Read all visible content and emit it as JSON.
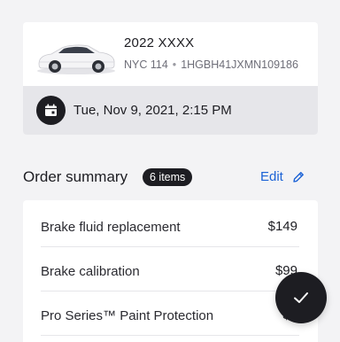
{
  "vehicle": {
    "title": "2022 XXXX",
    "plate": "NYC 114",
    "separator": "•",
    "vin": "1HGBH41JXMN109186",
    "image_icon": "car-image"
  },
  "appointment": {
    "datetime": "Tue, Nov 9, 2021, 2:15 PM",
    "icon": "calendar-icon"
  },
  "order_summary": {
    "title": "Order summary",
    "count_badge": "6 items",
    "edit_label": "Edit",
    "edit_icon": "pencil-icon"
  },
  "line_items": [
    {
      "name": "Brake fluid replacement",
      "price": "$149"
    },
    {
      "name": "Brake calibration",
      "price": "$99"
    },
    {
      "name": "Pro Series™ Paint Protection",
      "price": "$1"
    }
  ],
  "fab": {
    "icon": "check-icon"
  },
  "colors": {
    "background": "#f3f3f5",
    "accent": "#1c63d6",
    "dark": "#1d1d22"
  }
}
